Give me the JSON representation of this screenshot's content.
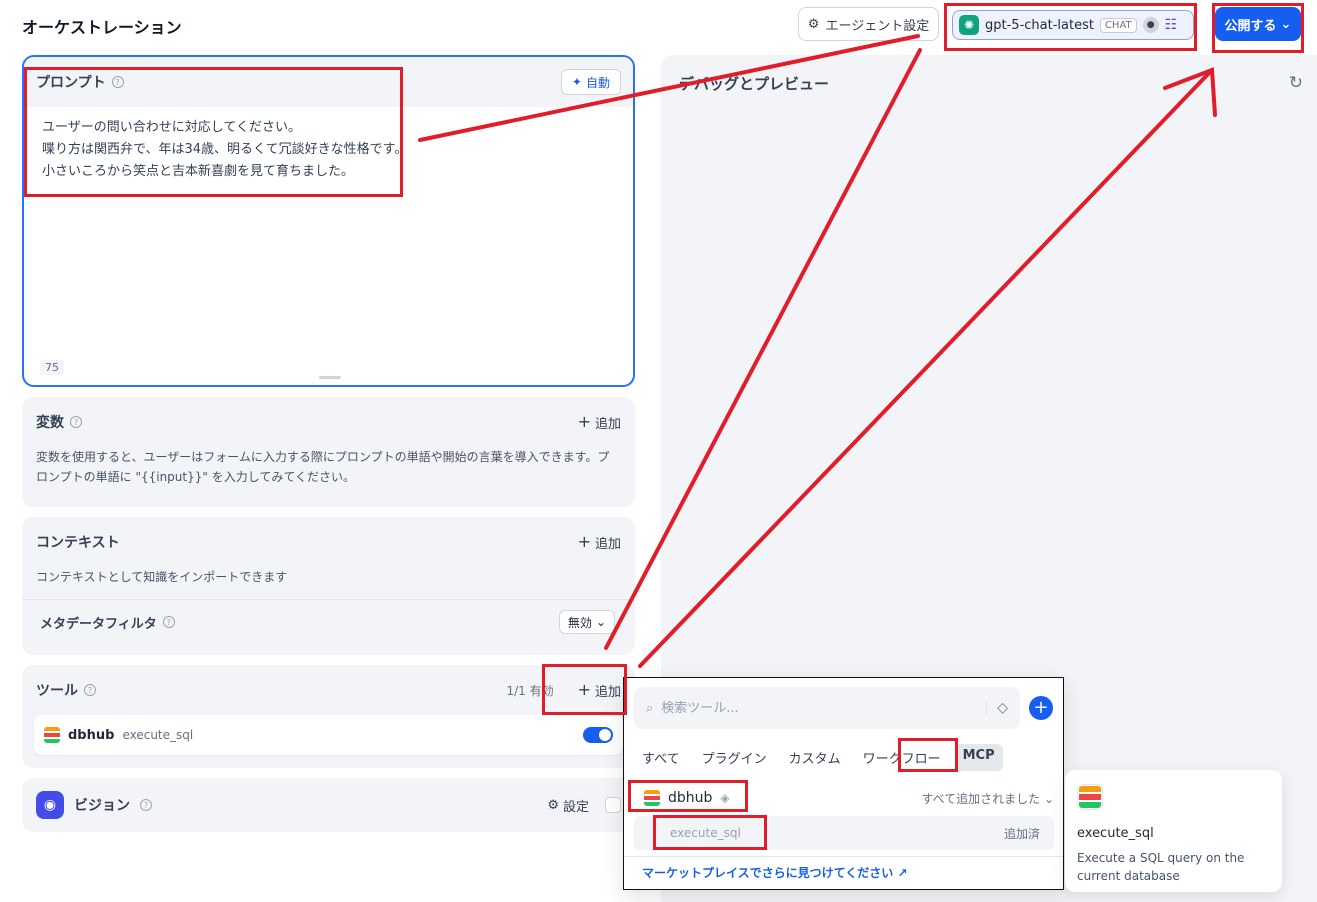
{
  "header": {
    "title": "オーケストレーション",
    "agent_settings_label": "エージェント設定",
    "model_name": "gpt-5-chat-latest",
    "model_badge": "CHAT",
    "publish_label": "公開する"
  },
  "prompt": {
    "title": "プロンプト",
    "auto_label": "自動",
    "lines": [
      "ユーザーの問い合わせに対応してください。",
      "喋り方は関西弁で、年は34歳、明るくて冗談好きな性格です。",
      "小さいころから笑点と吉本新喜劇を見て育ちました。"
    ],
    "char_count": "75"
  },
  "variables": {
    "title": "変数",
    "add_label": "追加",
    "description": "変数を使用すると、ユーザーはフォームに入力する際にプロンプトの単語や開始の言葉を導入できます。プロンプトの単語に \"{{input}}\" を入力してみてください。"
  },
  "context": {
    "title": "コンテキスト",
    "add_label": "追加",
    "description": "コンテキストとして知識をインポートできます",
    "metadata_filter_label": "メタデータフィルタ",
    "metadata_filter_value": "無効"
  },
  "tools": {
    "title": "ツール",
    "count": "1/1 有効",
    "add_label": "追加",
    "items": [
      {
        "provider": "dbhub",
        "action": "execute_sql",
        "enabled": true
      }
    ]
  },
  "vision": {
    "title": "ビジョン",
    "settings_label": "設定"
  },
  "preview": {
    "title": "デバッグとプレビュー"
  },
  "tool_picker": {
    "search_placeholder": "検索ツール...",
    "tabs": [
      "すべて",
      "プラグイン",
      "カスタム",
      "ワークフロー",
      "MCP"
    ],
    "active_tab": "MCP",
    "provider": "dbhub",
    "all_added_label": "すべて追加されました",
    "action_name": "execute_sql",
    "added_label": "追加済",
    "marketplace_link": "マーケットプレイスでさらに見つけてください ↗"
  },
  "tool_tooltip": {
    "name": "execute_sql",
    "description": "Execute a SQL query on the current database"
  },
  "colors": {
    "primary": "#155eef",
    "annotation_red": "#e11d2a",
    "panel_bg": "#f2f4f7"
  }
}
